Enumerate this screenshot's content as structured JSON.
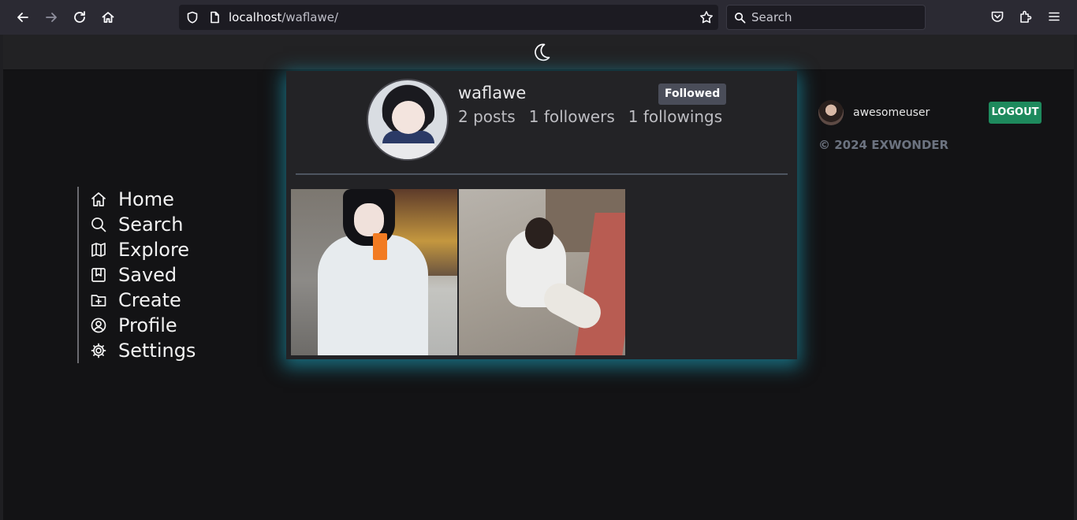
{
  "browser": {
    "url_host": "localhost",
    "url_path": "/waflawe/",
    "search_placeholder": "Search"
  },
  "sidebar": {
    "items": [
      {
        "label": "Home",
        "icon": "home-icon"
      },
      {
        "label": "Search",
        "icon": "search-icon"
      },
      {
        "label": "Explore",
        "icon": "map-icon"
      },
      {
        "label": "Saved",
        "icon": "bookmark-icon"
      },
      {
        "label": "Create",
        "icon": "folder-plus-icon"
      },
      {
        "label": "Profile",
        "icon": "user-circle-icon"
      },
      {
        "label": "Settings",
        "icon": "gear-icon"
      }
    ]
  },
  "profile": {
    "username": "waflawe",
    "follow_state": "Followed",
    "posts_count": "2",
    "posts_label": "posts",
    "followers_count": "1",
    "followers_label": "followers",
    "followings_count": "1",
    "followings_label": "followings"
  },
  "current_user": {
    "username": "awesomeuser",
    "logout_label": "LOGOUT"
  },
  "footer": {
    "copyright": "© 2024 EXWONDER"
  },
  "colors": {
    "accent_glow": "#1eb4d2",
    "logout_bg": "#1e8a5d",
    "followed_bg": "#4a4d59"
  }
}
